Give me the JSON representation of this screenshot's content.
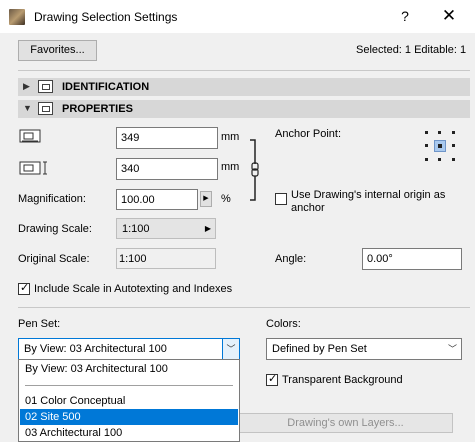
{
  "window": {
    "title": "Drawing Selection Settings",
    "help_label": "?",
    "close_label": "✕"
  },
  "toolbar": {
    "favorites_label": "Favorites...",
    "selected_info": "Selected: 1 Editable: 1"
  },
  "panels": {
    "identification": {
      "label": "IDENTIFICATION",
      "expanded": false
    },
    "properties": {
      "label": "PROPERTIES",
      "expanded": true
    }
  },
  "properties": {
    "width": {
      "value": "349",
      "unit": "mm"
    },
    "height": {
      "value": "340",
      "unit": "mm"
    },
    "magnification": {
      "label": "Magnification:",
      "value": "100.00",
      "unit": "%"
    },
    "drawing_scale": {
      "label": "Drawing Scale:",
      "value": "1:100"
    },
    "original_scale": {
      "label": "Original Scale:",
      "value": "1:100"
    },
    "anchor_point": {
      "label": "Anchor Point:"
    },
    "internal_origin": {
      "label": "Use Drawing's internal origin as anchor",
      "checked": false
    },
    "angle": {
      "label": "Angle:",
      "value": "0.00°"
    },
    "include_scale": {
      "label": "Include Scale in Autotexting and Indexes",
      "checked": true
    }
  },
  "pen_set": {
    "label": "Pen Set:",
    "selected": "By View: 03 Architectural 100",
    "options": [
      "By View: 03 Architectural 100",
      "01 Color Conceptual",
      "02 Site 500",
      "03 Architectural 100"
    ],
    "highlighted": "02 Site 500"
  },
  "colors": {
    "label": "Colors:",
    "selected": "Defined by Pen Set",
    "transparent_background": {
      "label": "Transparent Background",
      "checked": true
    }
  },
  "layers_button": {
    "label": "Drawing's own Layers..."
  }
}
